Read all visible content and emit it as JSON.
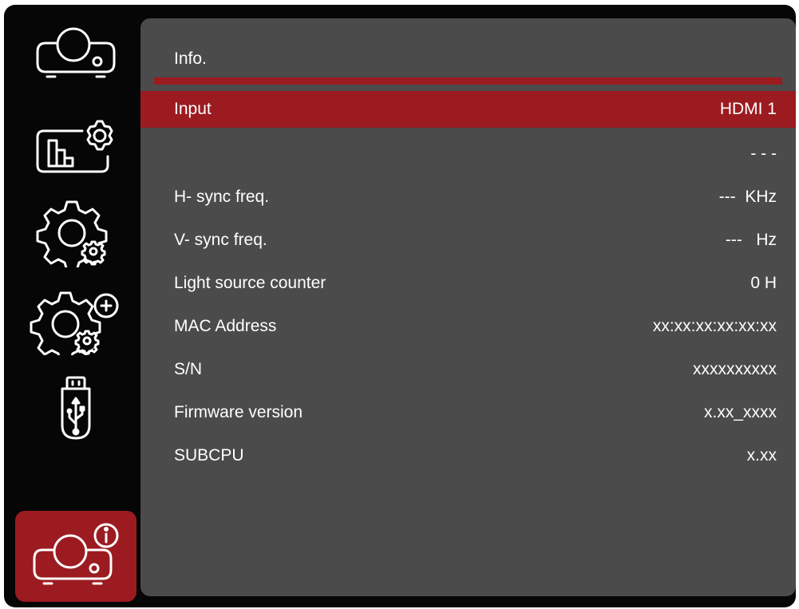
{
  "sidebar": {
    "items": [
      {
        "icon": "projector-icon",
        "active": false
      },
      {
        "icon": "image-settings-icon",
        "active": false
      },
      {
        "icon": "settings-gears-icon",
        "active": false
      },
      {
        "icon": "advanced-settings-icon",
        "active": false
      },
      {
        "icon": "usb-drive-icon",
        "active": false
      },
      {
        "icon": "projector-info-icon",
        "active": true
      }
    ]
  },
  "panel": {
    "title": "Info.",
    "rows": [
      {
        "label": "Input",
        "value": "HDMI 1",
        "selected": true
      },
      {
        "label": "",
        "value": "- - -",
        "selected": false
      },
      {
        "label": "H- sync freq.",
        "value": "---  KHz",
        "selected": false
      },
      {
        "label": "V- sync freq.",
        "value": "---   Hz",
        "selected": false
      },
      {
        "label": "Light source counter",
        "value": "0 H",
        "selected": false
      },
      {
        "label": "MAC Address",
        "value": "xx:xx:xx:xx:xx:xx",
        "selected": false
      },
      {
        "label": "S/N",
        "value": "xxxxxxxxxx",
        "selected": false
      },
      {
        "label": "Firmware version",
        "value": "x.xx_xxxx",
        "selected": false
      },
      {
        "label": "SUBCPU",
        "value": "x.xx",
        "selected": false
      }
    ]
  },
  "colors": {
    "accent": "#9b1b21",
    "panel": "#4b4b4b",
    "background": "#060606",
    "text": "#ffffff"
  }
}
